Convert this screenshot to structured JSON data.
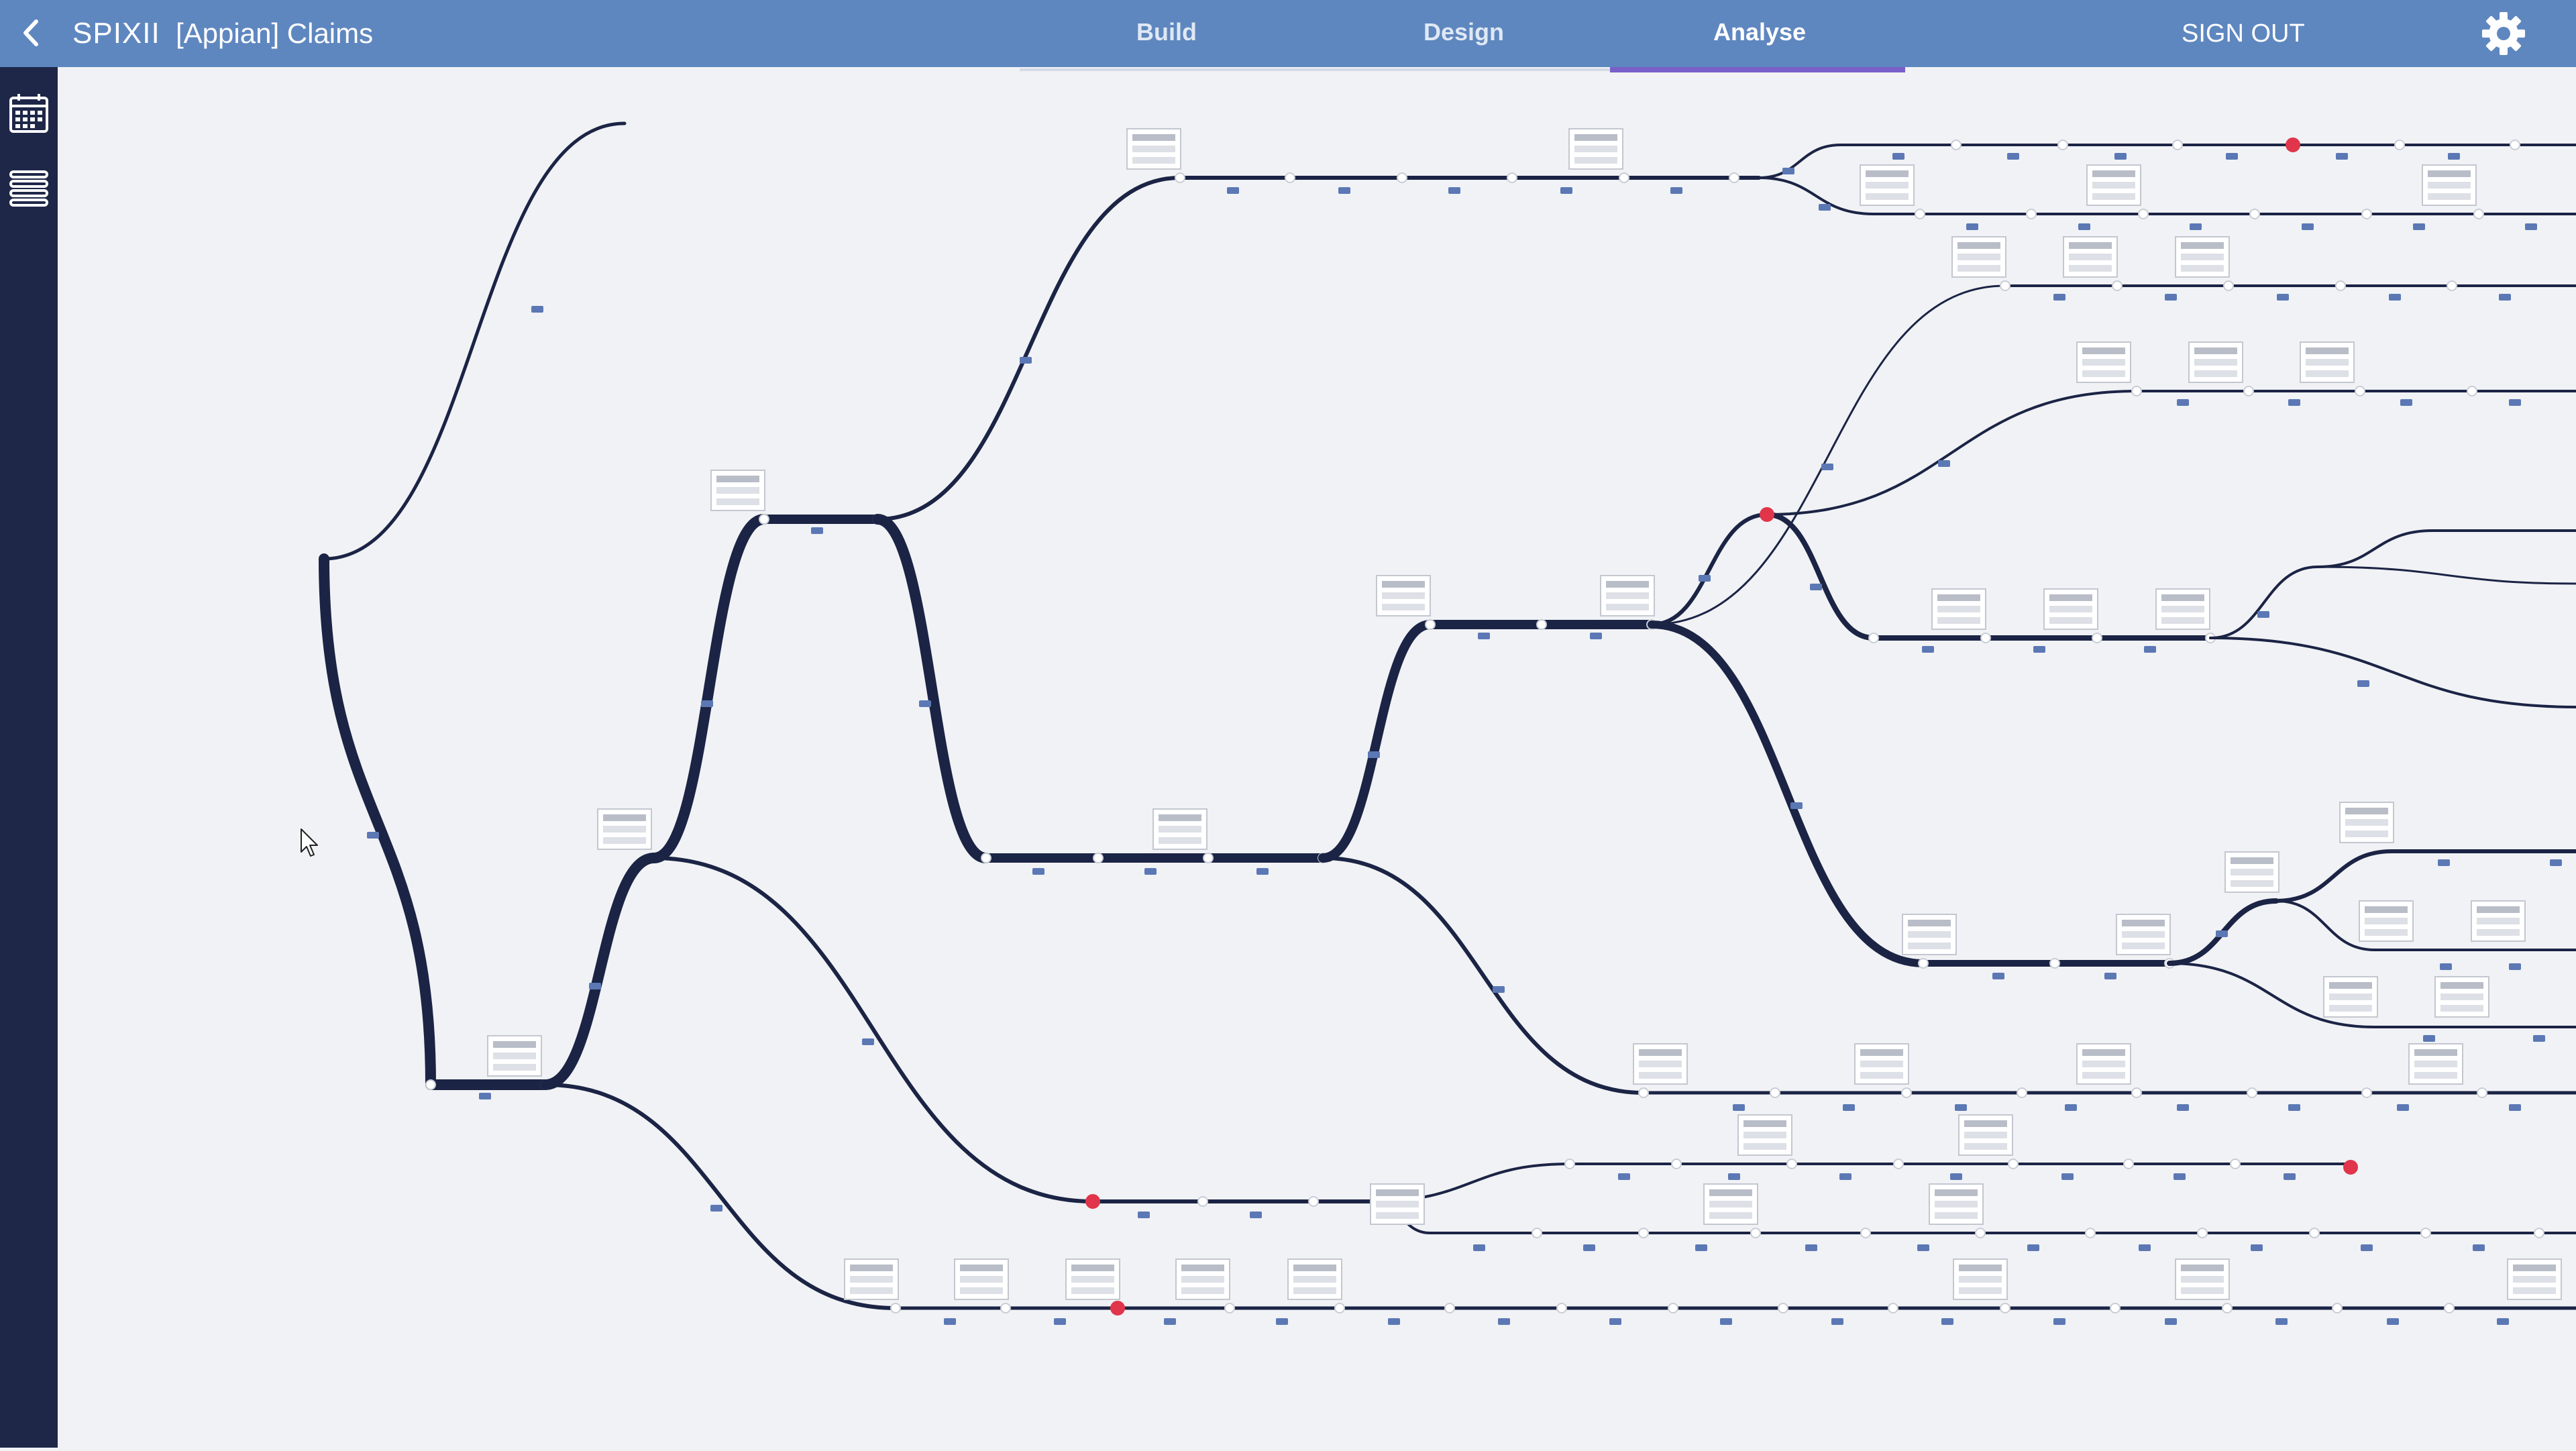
{
  "header": {
    "app_name": "SPIXII",
    "project_name": "[Appian] Claims",
    "tabs": [
      {
        "label": "Build",
        "active": false
      },
      {
        "label": "Design",
        "active": false
      },
      {
        "label": "Analyse",
        "active": true
      }
    ],
    "signout_label": "SIGN OUT"
  },
  "sidebar": {
    "items": [
      {
        "icon": "calendar-icon"
      },
      {
        "icon": "list-icon"
      }
    ]
  },
  "colors": {
    "header": "#5f87bf",
    "sidebar": "#1e2748",
    "canvas": "#f1f2f5",
    "path": "#1b2445",
    "node_marker": "#5b78b5",
    "active_tab_underline": "#7a5fc8",
    "highlight_node": "#e0354a"
  },
  "icons": {
    "back": "chevron-left-icon",
    "settings": "gear-icon",
    "cursor": "mouse-pointer-icon"
  }
}
